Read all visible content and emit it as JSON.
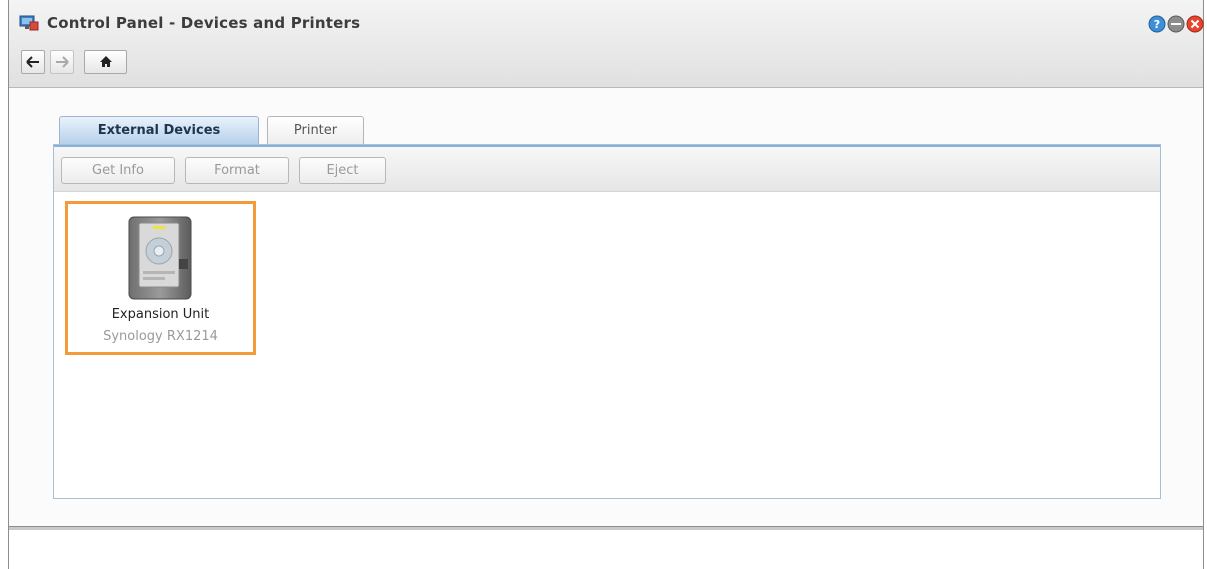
{
  "window": {
    "title": "Control Panel - Devices and Printers",
    "icon": "devices-printers-icon",
    "controls": [
      "help-icon",
      "minimize-icon",
      "close-icon"
    ]
  },
  "navigation": {
    "back_icon": "arrow-left-icon",
    "forward_icon": "arrow-right-icon",
    "home_icon": "home-icon"
  },
  "tabs": [
    {
      "label": "External Devices",
      "active": true
    },
    {
      "label": "Printer",
      "active": false
    }
  ],
  "toolbar": {
    "buttons": [
      {
        "label": "Get Info",
        "enabled": false
      },
      {
        "label": "Format",
        "enabled": false
      },
      {
        "label": "Eject",
        "enabled": false
      }
    ]
  },
  "devices": [
    {
      "name": "Expansion Unit",
      "model": "Synology RX1214",
      "selected": true,
      "icon": "expansion-unit-icon"
    }
  ],
  "colors": {
    "selection": "#f39a3a",
    "tab_active": "#b7d1ec",
    "close": "#e8452c",
    "help": "#3d8fd8"
  }
}
